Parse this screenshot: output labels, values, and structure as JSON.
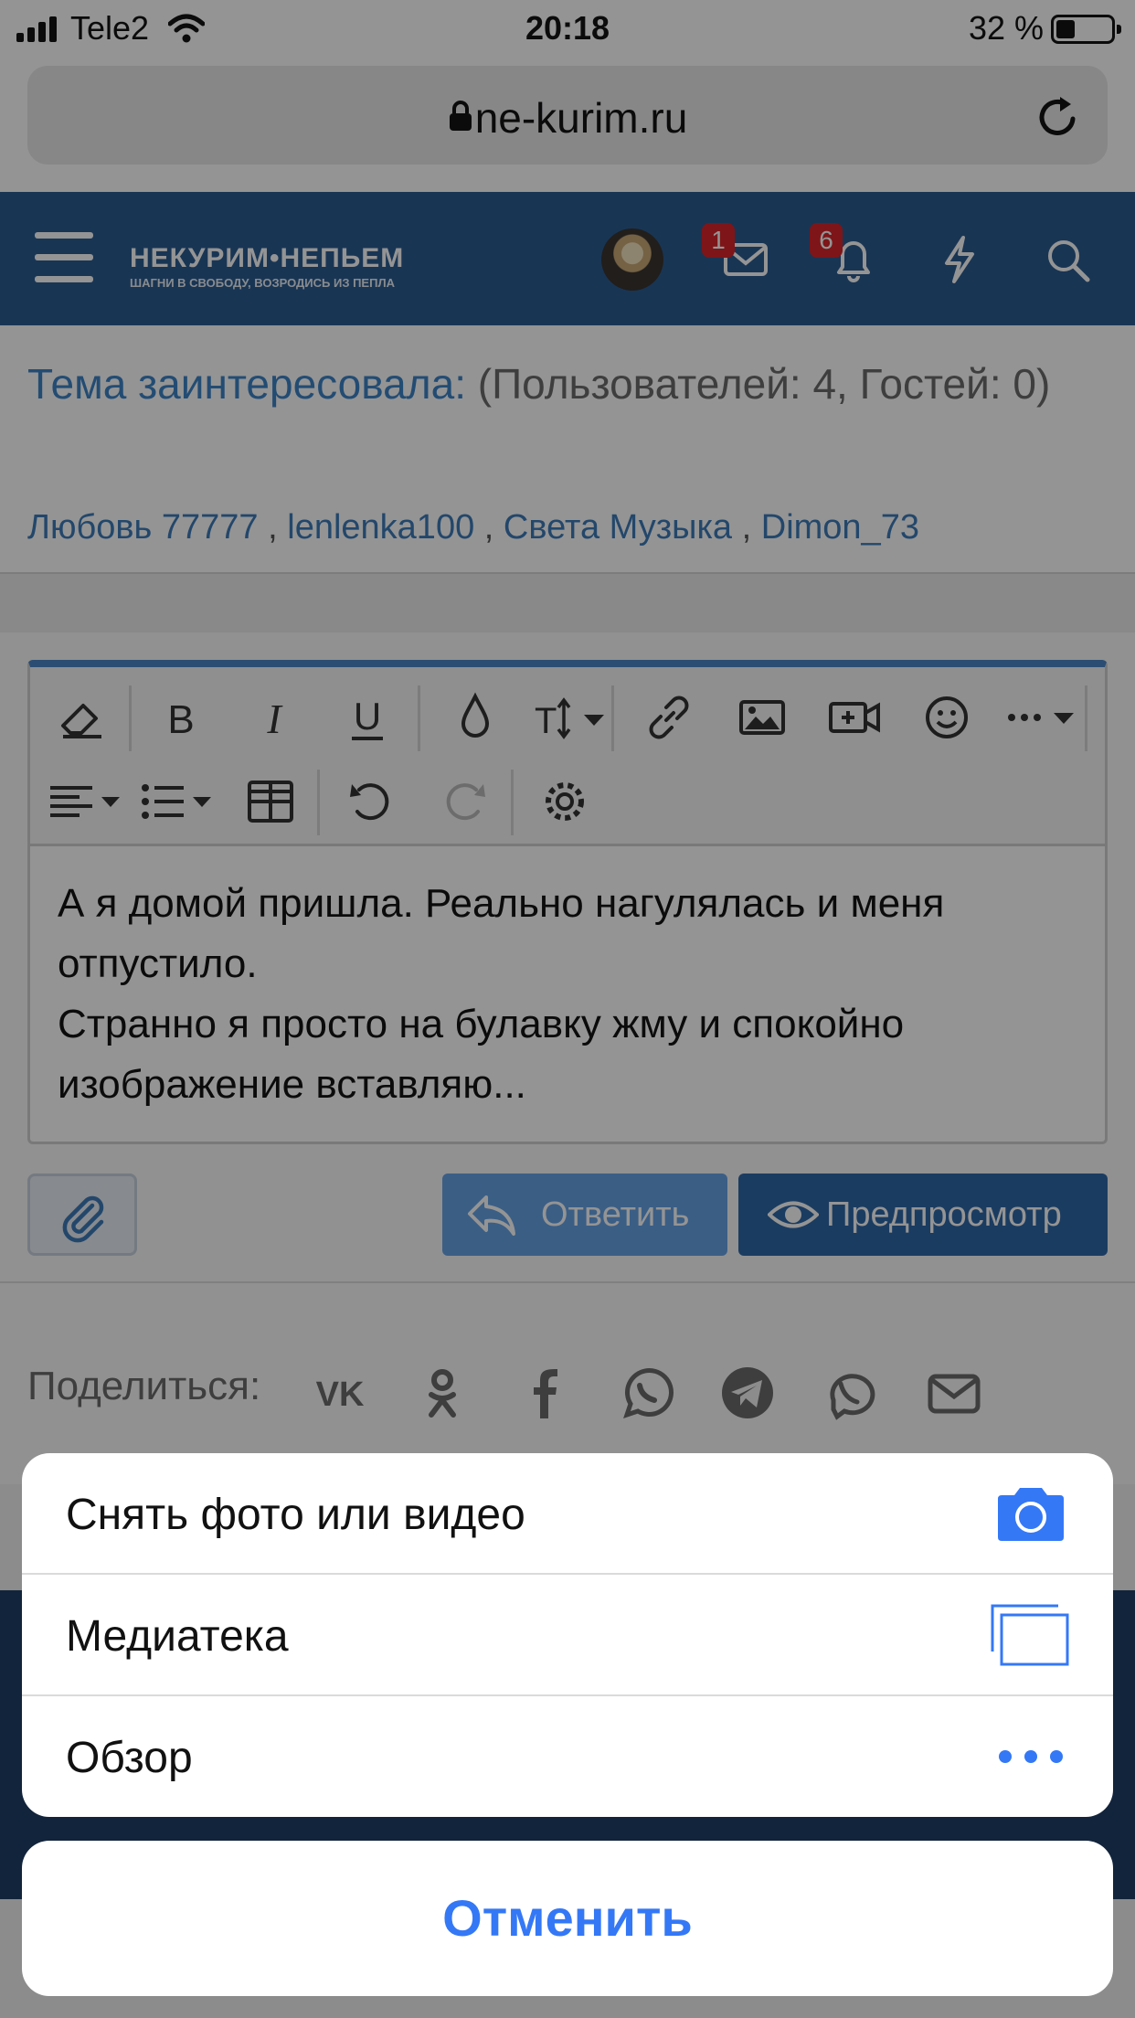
{
  "status_bar": {
    "carrier": "Tele2",
    "time": "20:18",
    "battery": "32 %"
  },
  "browser": {
    "domain": "ne-kurim.ru"
  },
  "header": {
    "logo_main": "НЕКУРИМ•НЕПЬЕМ",
    "logo_sub": "ШАГНИ В СВОБОДУ, ВОЗРОДИСЬ ИЗ ПЕПЛА",
    "messages_count": "1",
    "alerts_count": "6"
  },
  "who_is_viewing": {
    "lead": "Тема заинтересовала:",
    "rest": " (Пользователей: 4, Гостей: 0)",
    "users": [
      "Любовь 77777",
      "lenlenka100",
      "Света Музыка",
      "Dimon_73"
    ],
    "separator": " , "
  },
  "editor": {
    "line1": "А я домой пришла. Реально нагулялась и меня отпустило.",
    "line2": "Странно я просто на булавку жму и спокойно изображение вставляю..."
  },
  "buttons": {
    "reply": "Ответить",
    "preview": "Предпросмотр"
  },
  "share": {
    "label": "Поделиться:"
  },
  "action_sheet": {
    "items": [
      {
        "label": "Снять фото или видео",
        "icon": "camera-icon"
      },
      {
        "label": "Медиатека",
        "icon": "photo-library-icon"
      },
      {
        "label": "Обзор",
        "icon": "more-dots-icon"
      }
    ],
    "cancel": "Отменить"
  },
  "colors": {
    "header_blue": "#2b5c92",
    "ios_blue": "#3478f6",
    "link_blue": "#3d7ab8"
  }
}
